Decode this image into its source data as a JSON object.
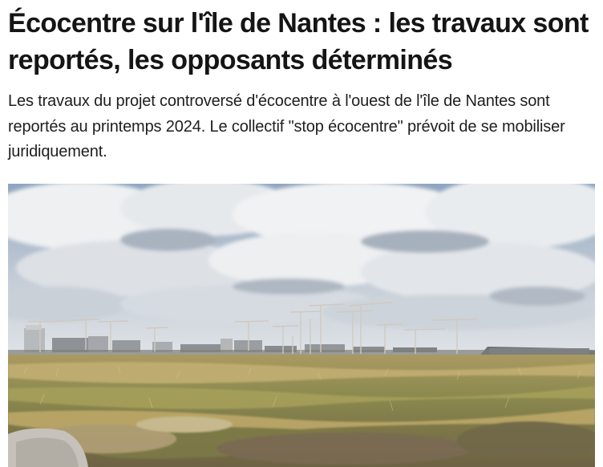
{
  "article": {
    "headline": "Écocentre sur l'île de Nantes : les travaux sont reportés, les opposants déterminés",
    "lede": "Les travaux du projet controversé d'écocentre à l'ouest de l'île de Nantes sont reportés au printemps 2024. Le collectif \"stop écocentre\" prévoit de se mobiliser juridiquement."
  },
  "photo": {
    "subject": "construction-cranes-over-wasteland-photo",
    "colors": {
      "sky_top": "#8fa6c2",
      "sky_bottom": "#d7dde3",
      "cloud": "#eef0f2",
      "cloud_shadow": "#a9b2bd",
      "field_dry": "#b8a56a",
      "field_green": "#6f7440",
      "ground": "#8a7c5e",
      "crane": "#d9d4c8",
      "building": "#9a9ea4"
    }
  }
}
